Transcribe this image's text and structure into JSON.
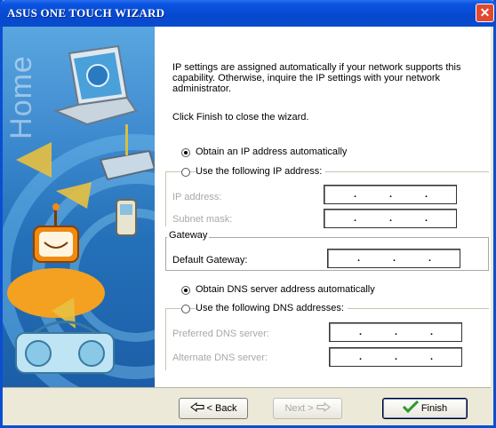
{
  "window": {
    "title": "ASUS ONE TOUCH WIZARD",
    "close_glyph": "✕"
  },
  "sidebar": {
    "watermark": "Home"
  },
  "intro": {
    "text": "IP settings are assigned automatically if your network supports this capability. Otherwise, inquire the IP settings with your network administrator.",
    "finish_note": "Click Finish to close the wizard."
  },
  "ip": {
    "auto_label": "Obtain an IP address automatically",
    "manual_label": "Use the following IP address:",
    "ip_address_label": "IP address:",
    "subnet_label": "Subnet mask:",
    "dot": "."
  },
  "gateway": {
    "group_title": "Gateway",
    "label": "Default Gateway:"
  },
  "dns": {
    "auto_label": "Obtain DNS server address automatically",
    "manual_label": "Use the following DNS addresses:",
    "preferred_label": "Preferred DNS server:",
    "alternate_label": "Alternate DNS server:"
  },
  "buttons": {
    "back": "< Back",
    "next": "Next >",
    "finish": "Finish"
  },
  "colors": {
    "titlebar": "#0a54e0",
    "accent": "#2a9a2a"
  }
}
